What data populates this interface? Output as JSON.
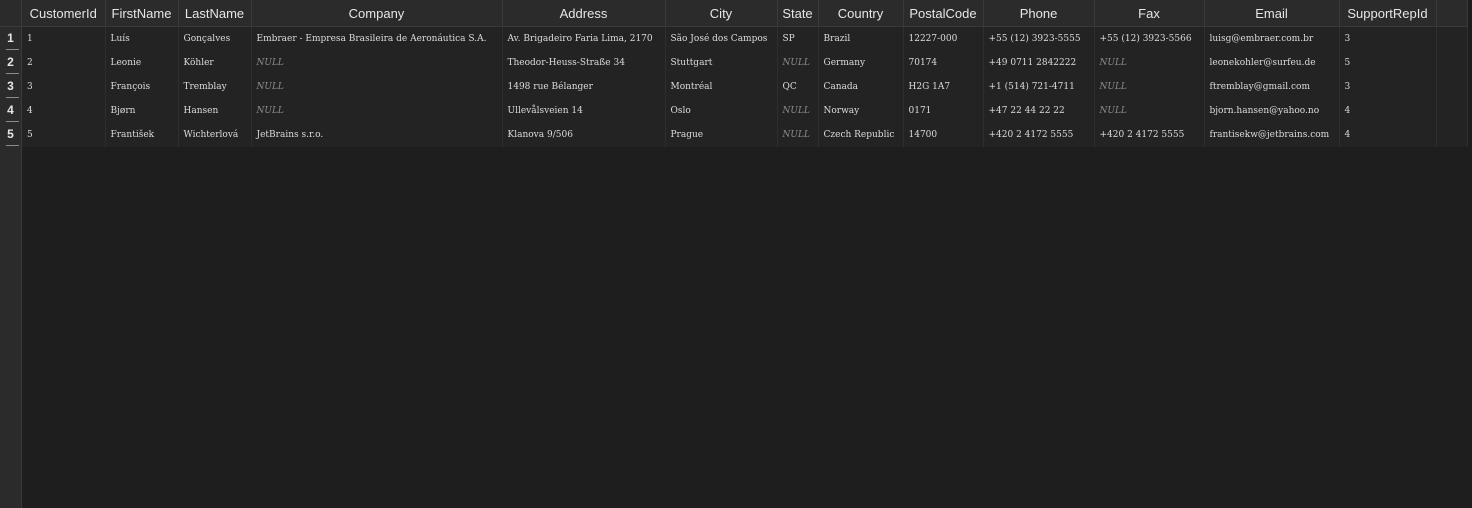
{
  "grid": {
    "columns": [
      "CustomerId",
      "FirstName",
      "LastName",
      "Company",
      "Address",
      "City",
      "State",
      "Country",
      "PostalCode",
      "Phone",
      "Fax",
      "Email",
      "SupportRepId"
    ],
    "row_numbers": [
      "1",
      "2",
      "3",
      "4",
      "5"
    ],
    "null_label": "NULL",
    "rows": [
      [
        "1",
        "Luís",
        "Gonçalves",
        "Embraer - Empresa Brasileira de Aeronáutica S.A.",
        "Av. Brigadeiro Faria Lima, 2170",
        "São José dos Campos",
        "SP",
        "Brazil",
        "12227-000",
        "+55 (12) 3923-5555",
        "+55 (12) 3923-5566",
        "luisg@embraer.com.br",
        "3"
      ],
      [
        "2",
        "Leonie",
        "Köhler",
        null,
        "Theodor-Heuss-Straße 34",
        "Stuttgart",
        null,
        "Germany",
        "70174",
        "+49 0711 2842222",
        null,
        "leonekohler@surfeu.de",
        "5"
      ],
      [
        "3",
        "François",
        "Tremblay",
        null,
        "1498 rue Bélanger",
        "Montréal",
        "QC",
        "Canada",
        "H2G 1A7",
        "+1 (514) 721-4711",
        null,
        "ftremblay@gmail.com",
        "3"
      ],
      [
        "4",
        "Bjørn",
        "Hansen",
        null,
        "Ullevålsveien 14",
        "Oslo",
        null,
        "Norway",
        "0171",
        "+47 22 44 22 22",
        null,
        "bjorn.hansen@yahoo.no",
        "4"
      ],
      [
        "5",
        "František",
        "Wichterlová",
        "JetBrains s.r.o.",
        "Klanova 9/506",
        "Prague",
        null,
        "Czech Republic",
        "14700",
        "+420 2 4172 5555",
        "+420 2 4172 5555",
        "frantisekw@jetbrains.com",
        "4"
      ]
    ]
  }
}
